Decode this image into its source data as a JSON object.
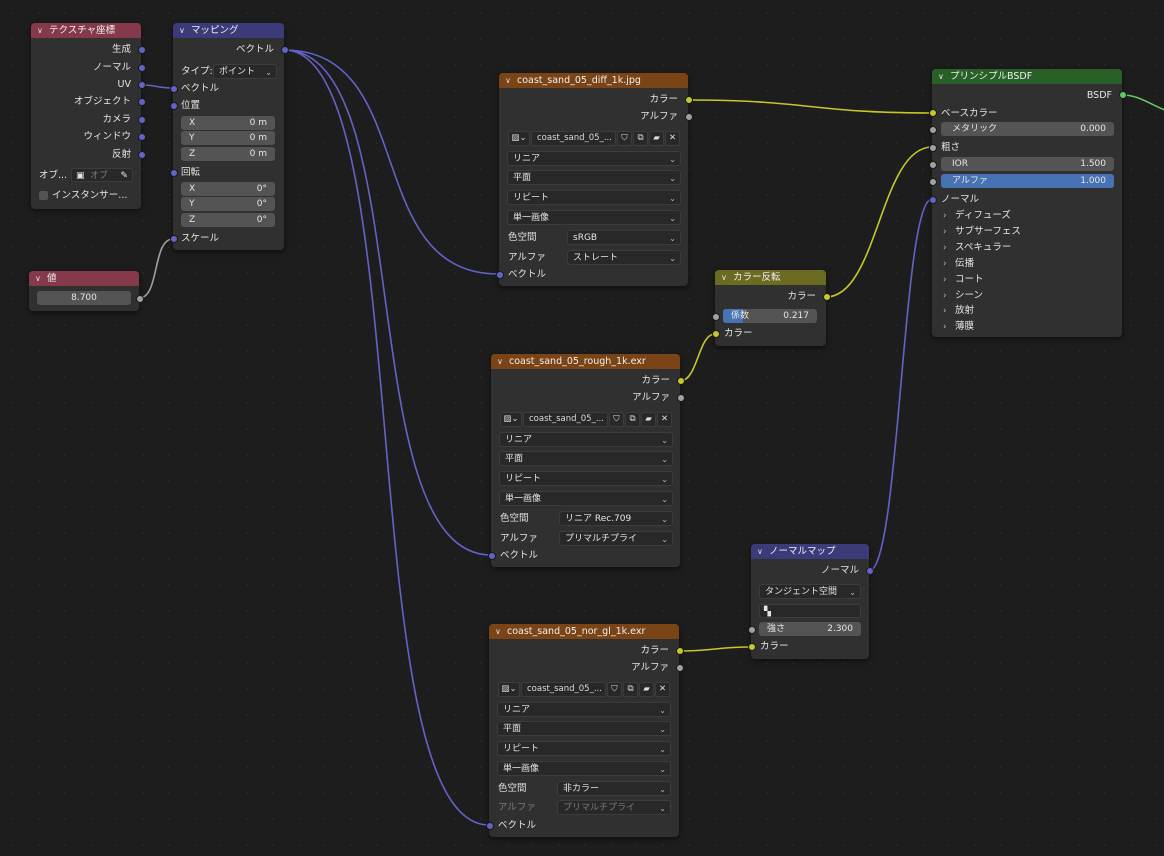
{
  "colors": {
    "header_texcoord": "#843a4a",
    "header_mapping": "#3b3b7a",
    "header_image": "#7a4416",
    "header_invert": "#6b6b21",
    "header_normalmap": "#3b3b7a",
    "header_bsdf": "#286028",
    "header_value": "#843a4a",
    "socket_vector": "#6363c7",
    "socket_color": "#c7c729",
    "socket_gray": "#a1a1a1",
    "socket_shader": "#63c763",
    "node_body": "#303030",
    "background": "#1d1d1d",
    "field_blue": "#4772b3"
  },
  "texcoord": {
    "title": "テクスチャ座標",
    "outputs": [
      "生成",
      "ノーマル",
      "UV",
      "オブジェクト",
      "カメラ",
      "ウィンドウ",
      "反射"
    ],
    "obj_label": "オブ...",
    "obj_placeholder": "オブ",
    "instancer": "インスタンサー..."
  },
  "mapping": {
    "title": "マッピング",
    "out_vector": "ベクトル",
    "type_label": "タイプ:",
    "type_value": "ポイント",
    "in_vector": "ベクトル",
    "location": "位置",
    "loc": [
      {
        "axis": "X",
        "value": "0 m"
      },
      {
        "axis": "Y",
        "value": "0 m"
      },
      {
        "axis": "Z",
        "value": "0 m"
      }
    ],
    "rotation": "回転",
    "rot": [
      {
        "axis": "X",
        "value": "0°"
      },
      {
        "axis": "Y",
        "value": "0°"
      },
      {
        "axis": "Z",
        "value": "0°"
      }
    ],
    "scale": "スケール"
  },
  "value_node": {
    "title": "値",
    "value": "8.700"
  },
  "img1": {
    "title": "coast_sand_05_diff_1k.jpg",
    "out_color": "カラー",
    "out_alpha": "アルファ",
    "fname": "coast_sand_05_...",
    "interp": "リニア",
    "proj": "平面",
    "ext": "リピート",
    "src": "単一画像",
    "cs_label": "色空間",
    "cs": "sRGB",
    "alpha_label": "アルファ",
    "alpha": "ストレート",
    "in_vector": "ベクトル"
  },
  "img2": {
    "title": "coast_sand_05_rough_1k.exr",
    "out_color": "カラー",
    "out_alpha": "アルファ",
    "fname": "coast_sand_05_...",
    "interp": "リニア",
    "proj": "平面",
    "ext": "リピート",
    "src": "単一画像",
    "cs_label": "色空間",
    "cs": "リニア Rec.709",
    "alpha_label": "アルファ",
    "alpha": "プリマルチプライ",
    "in_vector": "ベクトル"
  },
  "img3": {
    "title": "coast_sand_05_nor_gl_1k.exr",
    "out_color": "カラー",
    "out_alpha": "アルファ",
    "fname": "coast_sand_05_...",
    "interp": "リニア",
    "proj": "平面",
    "ext": "リピート",
    "src": "単一画像",
    "cs_label": "色空間",
    "cs": "非カラー",
    "alpha_label": "アルファ",
    "alpha": "プリマルチプライ",
    "in_vector": "ベクトル"
  },
  "invert": {
    "title": "カラー反転",
    "out_color": "カラー",
    "fac_label": "係数",
    "fac_value": "0.217",
    "in_color": "カラー"
  },
  "normalmap": {
    "title": "ノーマルマップ",
    "out_normal": "ノーマル",
    "space": "タンジェント空間",
    "strength_label": "強さ",
    "strength_value": "2.300",
    "in_color": "カラー"
  },
  "bsdf": {
    "title": "プリンシプルBSDF",
    "out": "BSDF",
    "base_color": "ベースカラー",
    "metallic_label": "メタリック",
    "metallic_value": "0.000",
    "roughness": "粗さ",
    "ior_label": "IOR",
    "ior_value": "1.500",
    "alpha_label": "アルファ",
    "alpha_value": "1.000",
    "normal": "ノーマル",
    "panels": [
      "ディフューズ",
      "サブサーフェス",
      "スペキュラー",
      "伝播",
      "コート",
      "シーン",
      "放射",
      "薄膜"
    ]
  }
}
